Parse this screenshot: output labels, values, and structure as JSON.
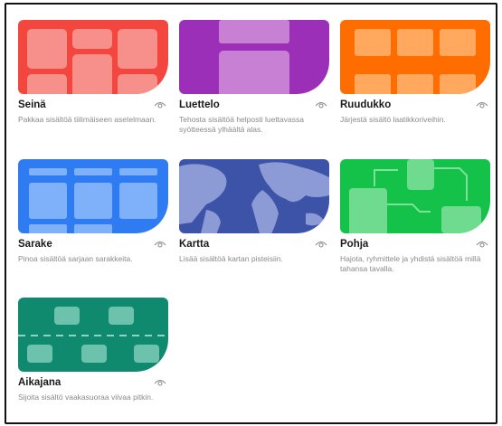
{
  "cards": [
    {
      "title": "Seinä",
      "desc": "Pakkaa sisältöä tiilimäiseen asetelmaan.",
      "color": "#f2463e",
      "icon": "wall-layout-icon"
    },
    {
      "title": "Luettelo",
      "desc": "Tehosta sisältöä helposti luettavassa syötteessä ylhäältä alas.",
      "color": "#9c2fb8",
      "icon": "list-layout-icon"
    },
    {
      "title": "Ruudukko",
      "desc": "Järjestä sisältö laatikkoriveihin.",
      "color": "#ff6d00",
      "icon": "grid-layout-icon"
    },
    {
      "title": "Sarake",
      "desc": "Pinoa sisältöä sarjaan sarakkeita.",
      "color": "#2f7cf2",
      "icon": "column-layout-icon"
    },
    {
      "title": "Kartta",
      "desc": "Lisää sisältöä kartan pisteisiin.",
      "color": "#3d53a8",
      "icon": "map-layout-icon"
    },
    {
      "title": "Pohja",
      "desc": "Hajota, ryhmittele ja yhdistä sisältöä millä tahansa tavalla.",
      "color": "#14c24a",
      "icon": "canvas-layout-icon"
    },
    {
      "title": "Aikajana",
      "desc": "Sijoita sisältö vaakasuoraa viivaa pitkin.",
      "color": "#0f8a6f",
      "icon": "timeline-layout-icon"
    }
  ]
}
